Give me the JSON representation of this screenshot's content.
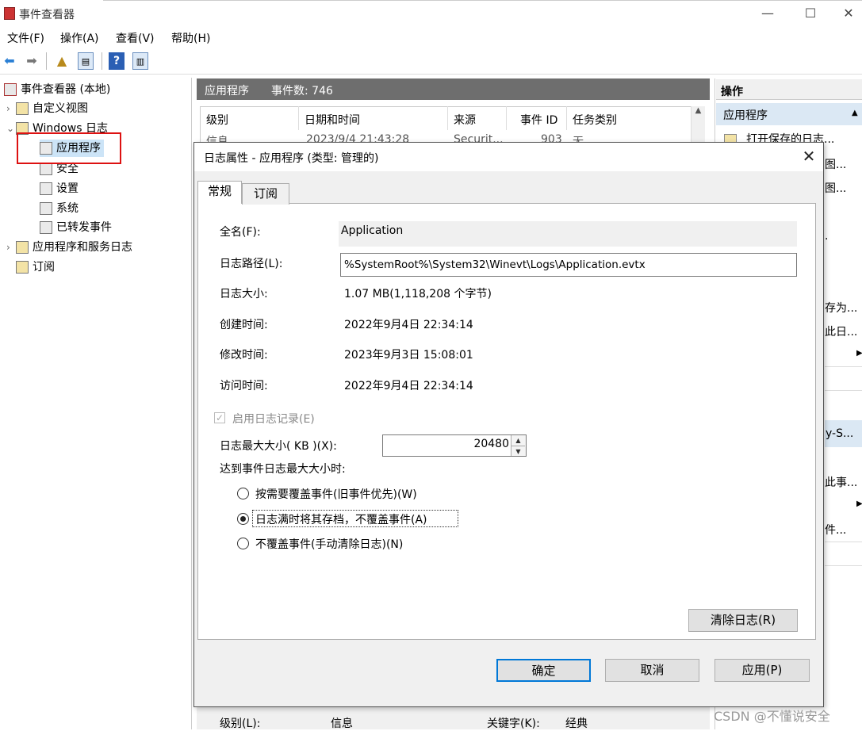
{
  "window": {
    "title": "事件查看器",
    "minimize": "—",
    "maximize": "☐",
    "close": "✕"
  },
  "menu": {
    "file": "文件",
    "file_key": "(F)",
    "action": "操作",
    "action_key": "(A)",
    "view": "查看",
    "view_key": "(V)",
    "help": "帮助",
    "help_key": "(H)"
  },
  "toolbar": {
    "back_icon": "arrow-left",
    "forward_icon": "arrow-right",
    "help_icon": "question"
  },
  "tree": {
    "root": "事件查看器 (本地)",
    "custom_views": "自定义视图",
    "windows_logs": "Windows 日志",
    "application": "应用程序",
    "security": "安全",
    "setup": "设置",
    "system": "系统",
    "forwarded": "已转发事件",
    "apps_services": "应用程序和服务日志",
    "subscriptions": "订阅"
  },
  "center": {
    "title": "应用程序",
    "count": "事件数: 746",
    "columns": [
      "级别",
      "日期和时间",
      "来源",
      "事件 ID",
      "任务类别"
    ],
    "row": [
      "信息",
      "2023/9/4 21:43:28",
      "Securit...",
      "903",
      "无"
    ],
    "bottom": {
      "level_label": "级别(L):",
      "level_value": "信息",
      "keyword_label": "关键字(K):",
      "keyword_value": "经典"
    }
  },
  "actions": {
    "title": "操作",
    "section": "应用程序",
    "items": [
      "打开保存的日志...",
      "图...",
      "图...",
      ".",
      "存为...",
      "此日...",
      "y-S...",
      "此事...",
      "件..."
    ]
  },
  "dialog": {
    "title": "日志属性 - 应用程序 (类型: 管理的)",
    "close": "✕",
    "tabs": [
      "常规",
      "订阅"
    ],
    "fields": {
      "fullname_label": "全名",
      "fullname_key": "(F)",
      "fullname_value": "Application",
      "path_label": "日志路径",
      "path_key": "(L)",
      "path_value": "%SystemRoot%\\System32\\Winevt\\Logs\\Application.evtx",
      "size_label": "日志大小:",
      "size_value": "1.07 MB(1,118,208 个字节)",
      "created_label": "创建时间:",
      "created_value": "2022年9月4日 22:34:14",
      "modified_label": "修改时间:",
      "modified_value": "2023年9月3日 15:08:01",
      "accessed_label": "访问时间:",
      "accessed_value": "2022年9月4日 22:34:14"
    },
    "enable_logging": {
      "label": "启用日志记录",
      "key": "(E)",
      "checked": true
    },
    "max_size": {
      "label": "日志最大大小( KB )",
      "key": "(X)",
      "value": "20480"
    },
    "policy_label": "达到事件日志最大大小时:",
    "radios": [
      {
        "label": "按需要覆盖事件(旧事件优先)",
        "key": "(W)",
        "selected": false
      },
      {
        "label": "日志满时将其存档，不覆盖事件",
        "key": "(A)",
        "selected": true
      },
      {
        "label": "不覆盖事件(手动清除日志)",
        "key": "(N)",
        "selected": false
      }
    ],
    "clear_button": "清除日志",
    "clear_key": "(R)",
    "ok": "确定",
    "cancel": "取消",
    "apply": "应用",
    "apply_key": "(P)"
  },
  "watermark": "CSDN @不懂说安全"
}
